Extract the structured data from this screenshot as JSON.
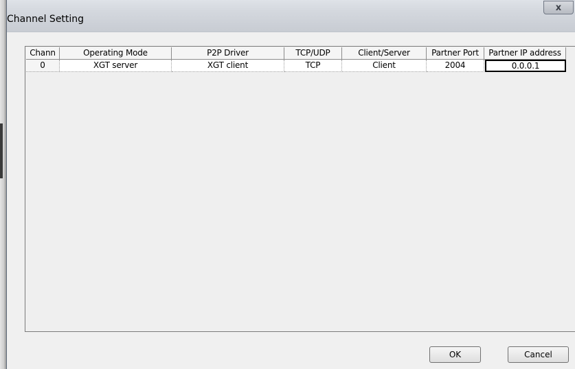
{
  "window": {
    "title": "Channel Setting",
    "close_glyph": "x"
  },
  "grid": {
    "columns": [
      "Chann",
      "Operating Mode",
      "P2P Driver",
      "TCP/UDP",
      "Client/Server",
      "Partner Port",
      "Partner IP address"
    ],
    "rows": [
      [
        "0",
        "XGT server",
        "XGT client",
        "TCP",
        "Client",
        "2004",
        "0.0.0.1"
      ]
    ]
  },
  "buttons": {
    "ok_label": "OK",
    "cancel_label": "Cancel"
  }
}
